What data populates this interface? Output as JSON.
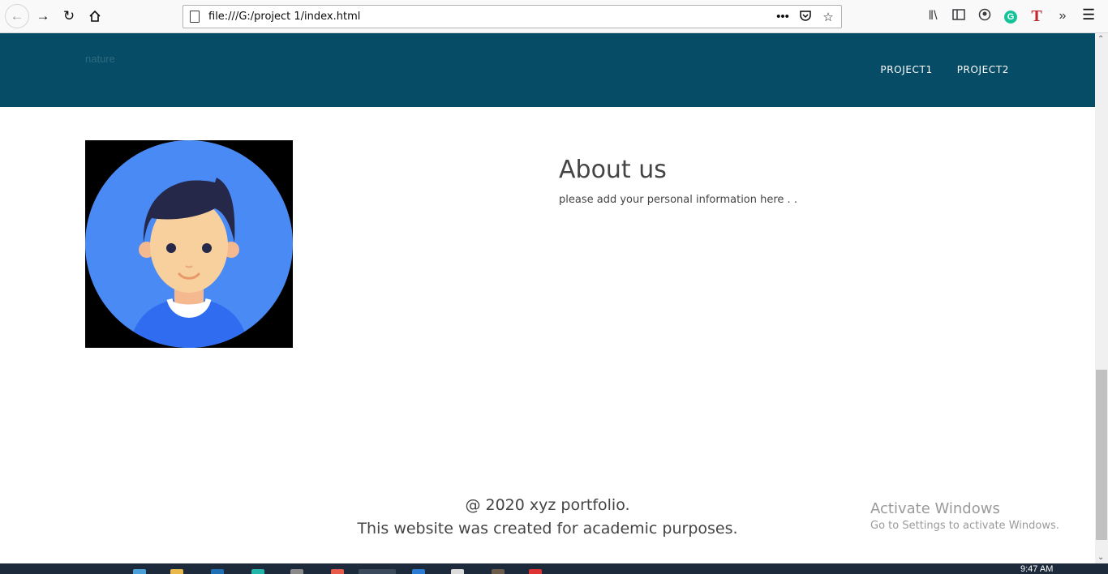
{
  "browser": {
    "url": "file:///G:/project 1/index.html",
    "icons": {
      "back": "arrow-left-icon",
      "forward": "arrow-right-icon",
      "reload": "reload-icon",
      "home": "home-icon",
      "page_actions": "ellipsis-icon",
      "pocket": "pocket-icon",
      "bookmark": "star-icon",
      "library": "library-icon",
      "sidebar": "sidebar-icon",
      "account": "account-icon",
      "grammarly": "G",
      "extension_t": "T",
      "overflow": "double-chevron-icon",
      "menu": "hamburger-menu-icon"
    }
  },
  "site": {
    "brand": "nature",
    "nav": [
      "PROJECT1",
      "PROJECT2"
    ],
    "header_color": "#074c66"
  },
  "about": {
    "title": "About us",
    "text": "please add your personal information here . ."
  },
  "footer": {
    "line1": "@ 2020 xyz portfolio.",
    "line2": "This website was created for academic purposes."
  },
  "watermark": {
    "title": "Activate Windows",
    "subtitle": "Go to Settings to activate Windows."
  },
  "taskbar": {
    "time": "9:47 AM"
  }
}
